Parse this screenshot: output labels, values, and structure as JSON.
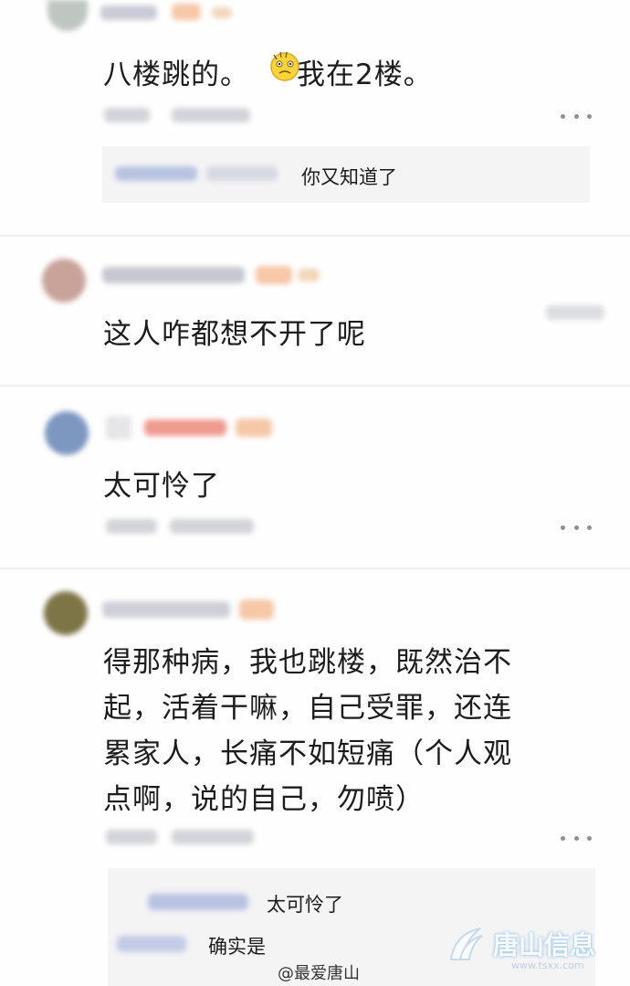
{
  "comments": [
    {
      "text_before_emoji": "八楼跳的。",
      "emoji": "awkward-face-emoji",
      "text_after_emoji": "我在2楼。",
      "reply": "你又知道了"
    },
    {
      "text": "这人咋都想不开了呢"
    },
    {
      "text": "太可怜了"
    },
    {
      "lines": [
        "得那种病，我也跳楼，既然治不",
        "起，活着干嘛，自己受罪，还连",
        "累家人，长痛不如短痛（个人观",
        "点啊，说的自己，勿喷）"
      ],
      "replies": [
        "太可怜了",
        "确实是"
      ]
    }
  ],
  "watermark": {
    "brand": "唐山信息",
    "url": "www.tsxx.com"
  },
  "source_credit": "@最爱唐山",
  "colors": {
    "text": "#1c1c1c",
    "reply_bg": "#f4f4f5",
    "more_dots": "#8f8f8f",
    "blur_name": "#c9cbd6",
    "blur_badge": "#f6c8a8"
  }
}
